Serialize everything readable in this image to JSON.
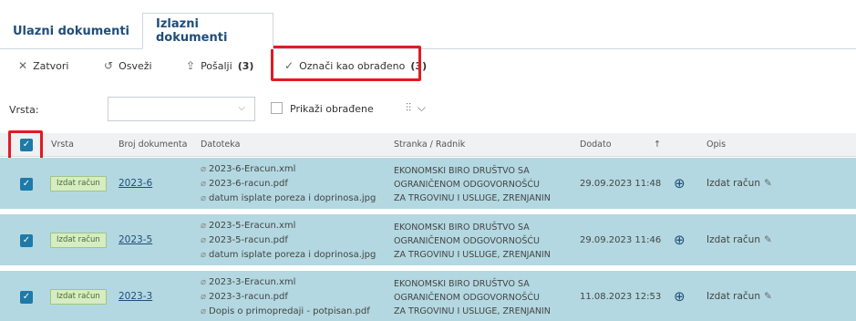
{
  "tabs": [
    {
      "label": "Ulazni dokumenti"
    },
    {
      "label": "Izlazni dokumenti"
    }
  ],
  "toolbar": {
    "close_label": "Zatvori",
    "refresh_label": "Osveži",
    "send_label": "Pošalji",
    "send_count": "(3)",
    "mark_label": "Označi kao obrađeno",
    "mark_count": "(3)"
  },
  "filter": {
    "vrsta_label": "Vrsta:",
    "select_value": "",
    "show_processed_label": "Prikaži obrađene"
  },
  "table": {
    "columns": [
      "Vrsta",
      "Broj dokumenta",
      "Datoteka",
      "Stranka / Radnik",
      "Dodato",
      "↑",
      "Opis"
    ],
    "rows": [
      {
        "vrsta": "Izdat račun",
        "broj": "2023-6",
        "files": [
          "2023-6-Eracun.xml",
          "2023-6-racun.pdf",
          "datum isplate poreza i doprinosa.jpg"
        ],
        "party": [
          "EKONOMSKI BIRO DRUŠTVO SA",
          "OGRANIČENOM ODGOVORNOŠĆU",
          "ZA TRGOVINU I USLUGE, ZRENJANIN"
        ],
        "dodato": "29.09.2023 11:48",
        "opis": "Izdat račun"
      },
      {
        "vrsta": "Izdat račun",
        "broj": "2023-5",
        "files": [
          "2023-5-Eracun.xml",
          "2023-5-racun.pdf",
          "datum isplate poreza i doprinosa.jpg"
        ],
        "party": [
          "EKONOMSKI BIRO DRUŠTVO SA",
          "OGRANIČENOM ODGOVORNOŠĆU",
          "ZA TRGOVINU I USLUGE, ZRENJANIN"
        ],
        "dodato": "29.09.2023 11:46",
        "opis": "Izdat račun"
      },
      {
        "vrsta": "Izdat račun",
        "broj": "2023-3",
        "files": [
          "2023-3-Eracun.xml",
          "2023-3-racun.pdf",
          "Dopis o primopredaji - potpisan.pdf"
        ],
        "party": [
          "EKONOMSKI BIRO DRUŠTVO SA",
          "OGRANIČENOM ODGOVORNOŠĆU",
          "ZA TRGOVINU I USLUGE, ZRENJANIN"
        ],
        "dodato": "11.08.2023 12:53",
        "opis": "Izdat račun"
      }
    ]
  },
  "colors": {
    "selected_row": "#b3d8e1",
    "accent": "#1e7aa8",
    "highlight": "#e01b22"
  },
  "icons": [
    "close-icon",
    "refresh-icon",
    "send-icon",
    "check-icon",
    "chevron-down-icon",
    "settings-icon",
    "sort-asc-icon",
    "paperclip-icon",
    "globe-icon",
    "pencil-icon"
  ]
}
